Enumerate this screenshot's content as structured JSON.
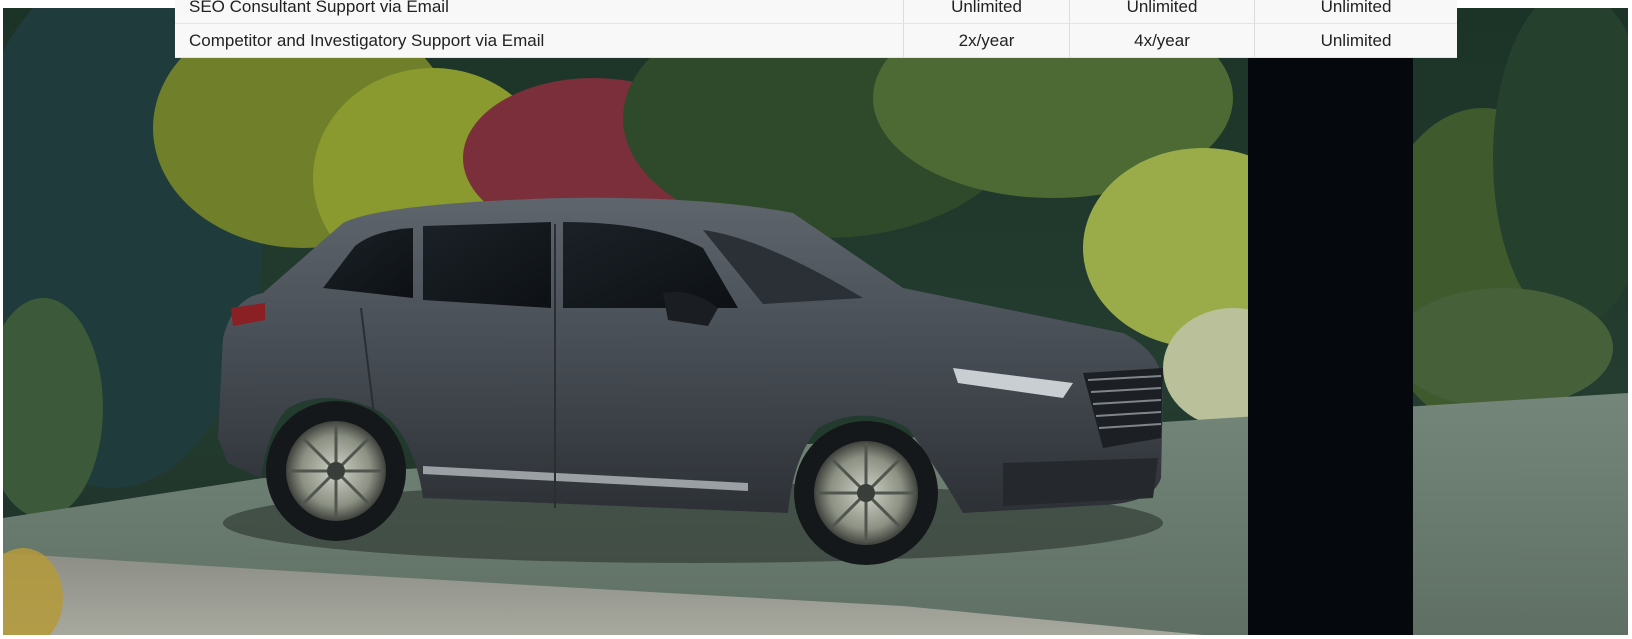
{
  "table": {
    "rows": [
      {
        "feature": "SEO Consultant Support via Email",
        "values": [
          "Unlimited",
          "Unlimited",
          "Unlimited"
        ]
      },
      {
        "feature": "Competitor and Investigatory Support via Email",
        "values": [
          "2x/year",
          "4x/year",
          "Unlimited"
        ]
      }
    ]
  },
  "colors": {
    "table_bg": "#f8f8f8",
    "table_text": "#222222",
    "foliage_dark": "#1f3a2c",
    "foliage_light": "#9db04a",
    "car_body": "#4a5056",
    "lawn": "#6c7d6f",
    "pillar": "#05080d"
  }
}
